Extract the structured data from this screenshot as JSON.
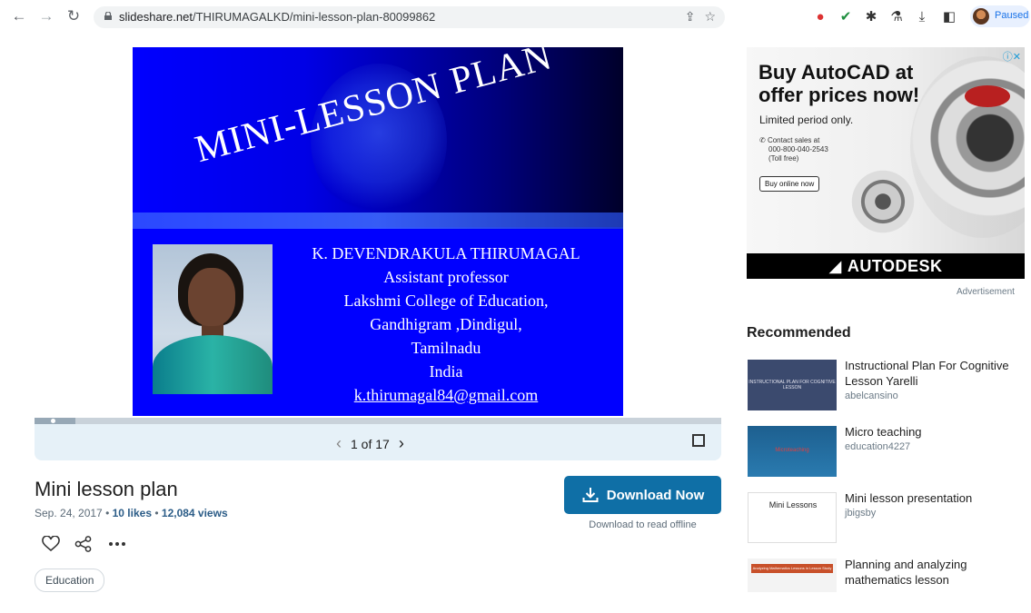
{
  "browser": {
    "url_domain": "slideshare.net",
    "url_path": "/THIRUMAGALKD/mini-lesson-plan-80099862",
    "profile_label": "Paused",
    "icons": [
      "back-icon",
      "forward-icon",
      "reload-icon",
      "lock-icon",
      "share-icon",
      "star-icon",
      "extension-icon",
      "check-icon",
      "puzzle-icon",
      "flask-icon",
      "download-icon",
      "sidepanel-icon"
    ]
  },
  "slide": {
    "title": "MINI-LESSON PLAN",
    "name": "K. DEVENDRAKULA THIRUMAGAL",
    "role": "Assistant professor",
    "college": "Lakshmi College of Education,",
    "place": "Gandhigram ,Dindigul,",
    "state": "Tamilnadu",
    "country": "India",
    "email": "k.thirumagal84@gmail.com"
  },
  "player": {
    "page_label": "1 of 17",
    "progress_fraction": 0.06
  },
  "document": {
    "title": "Mini lesson plan",
    "date": "Sep. 24, 2017",
    "likes": "10 likes",
    "views": "12,084 views",
    "separator": "•",
    "tag": "Education"
  },
  "download": {
    "label": "Download Now",
    "sublabel": "Download to read offline"
  },
  "ad": {
    "headline_1": "Buy AutoCAD at",
    "headline_2": "offer prices now!",
    "sub": "Limited period only.",
    "contact_1": "Contact sales at",
    "contact_2": "000-800-040-2543",
    "contact_3": "(Toll free)",
    "button": "Buy online now",
    "brand": "AUTODESK",
    "label": "Advertisement"
  },
  "recommended": {
    "heading": "Recommended",
    "items": [
      {
        "title": "Instructional Plan For Cognitive Lesson Yarelli",
        "author": "abelcansino",
        "thumb_text": "INSTRUCTIONAL PLAN FOR COGNITIVE LESSON"
      },
      {
        "title": "Micro teaching",
        "author": "education4227",
        "thumb_text": "Microteaching"
      },
      {
        "title": "Mini lesson presentation",
        "author": "jbigsby",
        "thumb_text": "Mini Lessons"
      },
      {
        "title": "Planning and analyzing mathematics lesson",
        "author": "",
        "thumb_text": "Analyzing Mathematics Lessons in Lesson Study"
      }
    ]
  },
  "colors": {
    "accent": "#0f6fa6",
    "slide_blue": "#0000ff",
    "player_bg": "#e6f1f8"
  }
}
